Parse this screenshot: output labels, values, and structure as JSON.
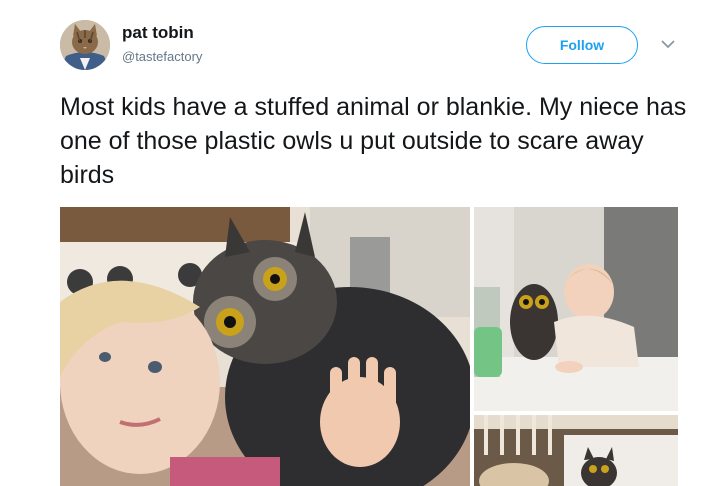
{
  "author": {
    "display_name": "pat tobin",
    "handle": "@tastefactory",
    "avatar_icon": "cat-avatar-icon"
  },
  "actions": {
    "follow_label": "Follow",
    "more_icon": "chevron-down-icon"
  },
  "tweet": {
    "text": "Most kids have a stuffed animal or blankie. My niece has one of those plastic owls u put outside to scare away birds"
  },
  "media": {
    "photo_count": 3,
    "photos": [
      {
        "subject": "child-hugging-plastic-owl"
      },
      {
        "subject": "child-at-table-with-owl"
      },
      {
        "subject": "child-in-crib-with-owl"
      }
    ]
  },
  "colors": {
    "accent": "#1da1f2",
    "text": "#14171a",
    "muted": "#657786"
  }
}
